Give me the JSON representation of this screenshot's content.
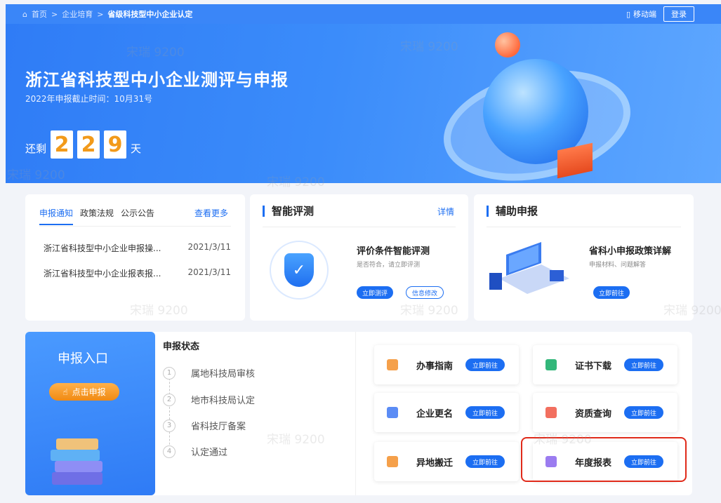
{
  "breadcrumb": {
    "home": "首页",
    "sep": ">",
    "level1": "企业培育",
    "current": "省级科技型中小企业认定"
  },
  "header": {
    "mobile": "移动端",
    "login": "登录"
  },
  "hero": {
    "title": "浙江省科技型中小企业测评与申报",
    "deadline": "2022年申报截止时间：10月31号",
    "prefix": "还剩",
    "digits": [
      "2",
      "2",
      "9"
    ],
    "suffix": "天"
  },
  "news": {
    "tabs": [
      "申报通知",
      "政策法规",
      "公示公告"
    ],
    "more": "查看更多",
    "items": [
      {
        "title": "浙江省科技型中小企业申报操...",
        "date": "2021/3/11"
      },
      {
        "title": "浙江省科技型中小企业报表报...",
        "date": "2021/3/11"
      }
    ]
  },
  "eval": {
    "title": "智能评测",
    "detail": "详情",
    "heading": "评价条件智能评测",
    "sub": "是否符合，请立即评测",
    "btn1": "立即测评",
    "btn2": "信息修改"
  },
  "aux": {
    "title": "辅助申报",
    "heading": "省科小申报政策详解",
    "sub": "申报材料、问题解答",
    "btn": "立即前往"
  },
  "entry": {
    "title": "申报入口",
    "button": "点击申报"
  },
  "status": {
    "title": "申报状态",
    "steps": [
      {
        "num": "1",
        "label": "属地科技局审核"
      },
      {
        "num": "2",
        "label": "地市科技局认定"
      },
      {
        "num": "3",
        "label": "省科技厅备案"
      },
      {
        "num": "4",
        "label": "认定通过"
      }
    ]
  },
  "services": [
    {
      "name": "办事指南",
      "btn": "立即前往",
      "color": "#f5a04a"
    },
    {
      "name": "证书下载",
      "btn": "立即前往",
      "color": "#33b77a"
    },
    {
      "name": "企业更名",
      "btn": "立即前往",
      "color": "#5b8cf5"
    },
    {
      "name": "资质查询",
      "btn": "立即前往",
      "color": "#f26f5f"
    },
    {
      "name": "异地搬迁",
      "btn": "立即前往",
      "color": "#f5a04a"
    },
    {
      "name": "年度报表",
      "btn": "立即前往",
      "color": "#9b7cf0"
    }
  ],
  "watermark": "宋瑞 9200"
}
